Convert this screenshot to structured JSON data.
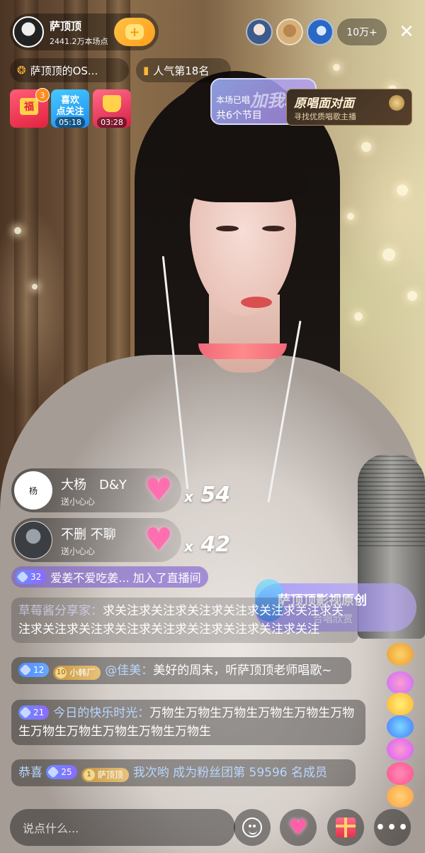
{
  "host": {
    "name": "萨顶顶",
    "stats": "2441.2万本场点"
  },
  "viewers": {
    "count": "10万+"
  },
  "pills": {
    "fan_club": "萨顶顶的OS...",
    "popularity": "人气第18名"
  },
  "tiles": {
    "badge_count": "3",
    "envelope_label": "福",
    "follow_line1": "喜欢",
    "follow_line2": "点关注",
    "follow_timer": "05:18",
    "gift_timer": "03:28"
  },
  "song_card": {
    "line1": "本场已唱",
    "line2": "共6个节目",
    "overlay": "加我粉"
  },
  "duet_card": {
    "title": "原唱面对面",
    "subtitle": "寻找优质唱歌主播"
  },
  "gifts": [
    {
      "user": "大杨　D&Y",
      "desc": "送小心心",
      "avatar_text": "杨",
      "count": "54"
    },
    {
      "user": "不删 不聊",
      "desc": "送小心心",
      "avatar_text": "",
      "count": "42"
    }
  ],
  "chat": {
    "join": {
      "level": "32",
      "text": "爱姜不爱吃姜... 加入了直播间"
    },
    "msg1": {
      "user": "草莓酱分享家：",
      "text": "求关注求关注求关注求关注求关注求关注求关注求关注求关注求关注求关注求关注求关注求关注求关注"
    },
    "msg2": {
      "level": "12",
      "fan_level": "10",
      "fan_name": "小韩厂",
      "user": "@佳美：",
      "text": "美好的周末，听萨顶顶老师唱歌~"
    },
    "msg3": {
      "level": "21",
      "user": "今日的快乐时光：",
      "text": "万物生万物生万物生万物生万物生万物生万物生万物生万物生万物生万物生"
    },
    "msg4": {
      "prefix": "恭喜",
      "level": "25",
      "fan_level": "1",
      "fan_name": "萨顶顶",
      "user": "我次哟",
      "text": "成为粉丝团第 59596 名成员"
    }
  },
  "banner": {
    "title": "萨顶顶影视原创",
    "subtitle": "合唱欣赏"
  },
  "bottom": {
    "input_placeholder": "说点什么..."
  },
  "colors": {
    "accent_orange": "#ff9e1b",
    "level_purple": "#8c6bff",
    "fan_gold": "#c59640",
    "heart_pink": "#ff6fb0"
  }
}
